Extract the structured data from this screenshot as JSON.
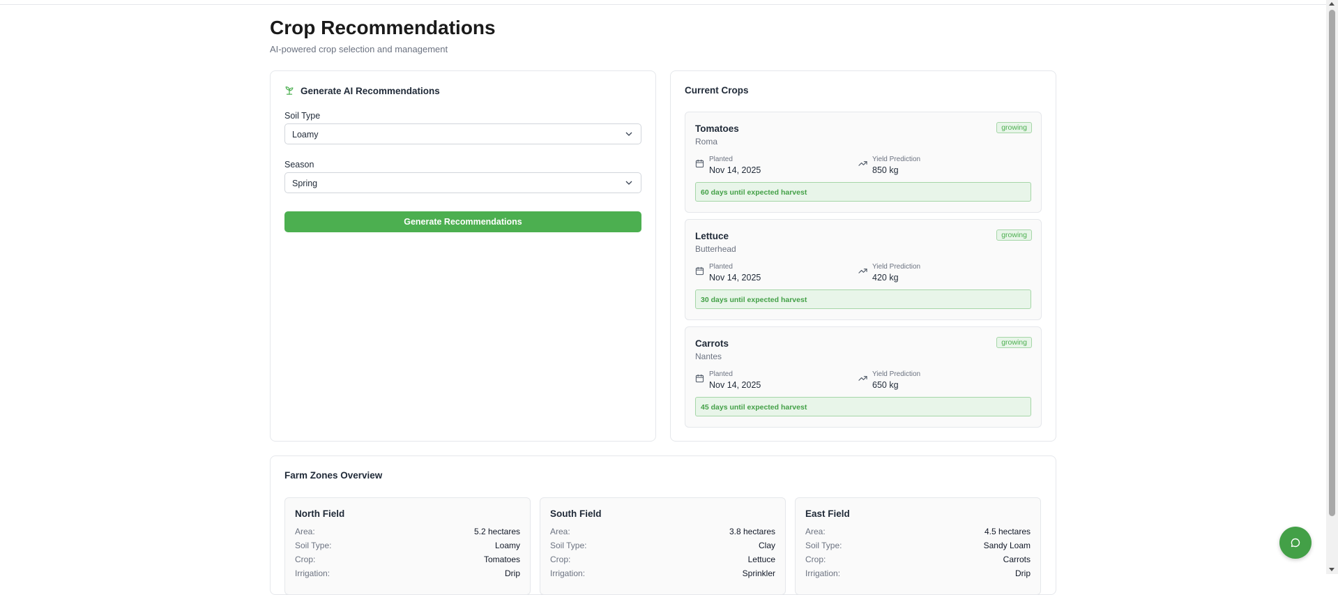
{
  "page": {
    "title": "Crop Recommendations",
    "subtitle": "AI-powered crop selection and management"
  },
  "generator": {
    "title": "Generate AI Recommendations",
    "icon": "sprout-icon",
    "soil_label": "Soil Type",
    "soil_value": "Loamy",
    "season_label": "Season",
    "season_value": "Spring",
    "button_label": "Generate Recommendations",
    "accent": "#4caf50"
  },
  "crops": {
    "title": "Current Crops",
    "planted_label": "Planted",
    "yield_label": "Yield Prediction",
    "items": [
      {
        "name": "Tomatoes",
        "variety": "Roma",
        "status": "growing",
        "planted": "Nov 14, 2025",
        "yield": "850 kg",
        "harvest": "60 days until expected harvest"
      },
      {
        "name": "Lettuce",
        "variety": "Butterhead",
        "status": "growing",
        "planted": "Nov 14, 2025",
        "yield": "420 kg",
        "harvest": "30 days until expected harvest"
      },
      {
        "name": "Carrots",
        "variety": "Nantes",
        "status": "growing",
        "planted": "Nov 14, 2025",
        "yield": "650 kg",
        "harvest": "45 days until expected harvest"
      }
    ]
  },
  "zones": {
    "title": "Farm Zones Overview",
    "area_label": "Area:",
    "soil_label": "Soil Type:",
    "crop_label": "Crop:",
    "irrigation_label": "Irrigation:",
    "items": [
      {
        "name": "North Field",
        "area": "5.2 hectares",
        "soil": "Loamy",
        "crop": "Tomatoes",
        "irrigation": "Drip"
      },
      {
        "name": "South Field",
        "area": "3.8 hectares",
        "soil": "Clay",
        "crop": "Lettuce",
        "irrigation": "Sprinkler"
      },
      {
        "name": "East Field",
        "area": "4.5 hectares",
        "soil": "Sandy Loam",
        "crop": "Carrots",
        "irrigation": "Drip"
      }
    ]
  },
  "chat": {
    "icon": "chat-bubble-icon",
    "color": "#43a047"
  }
}
